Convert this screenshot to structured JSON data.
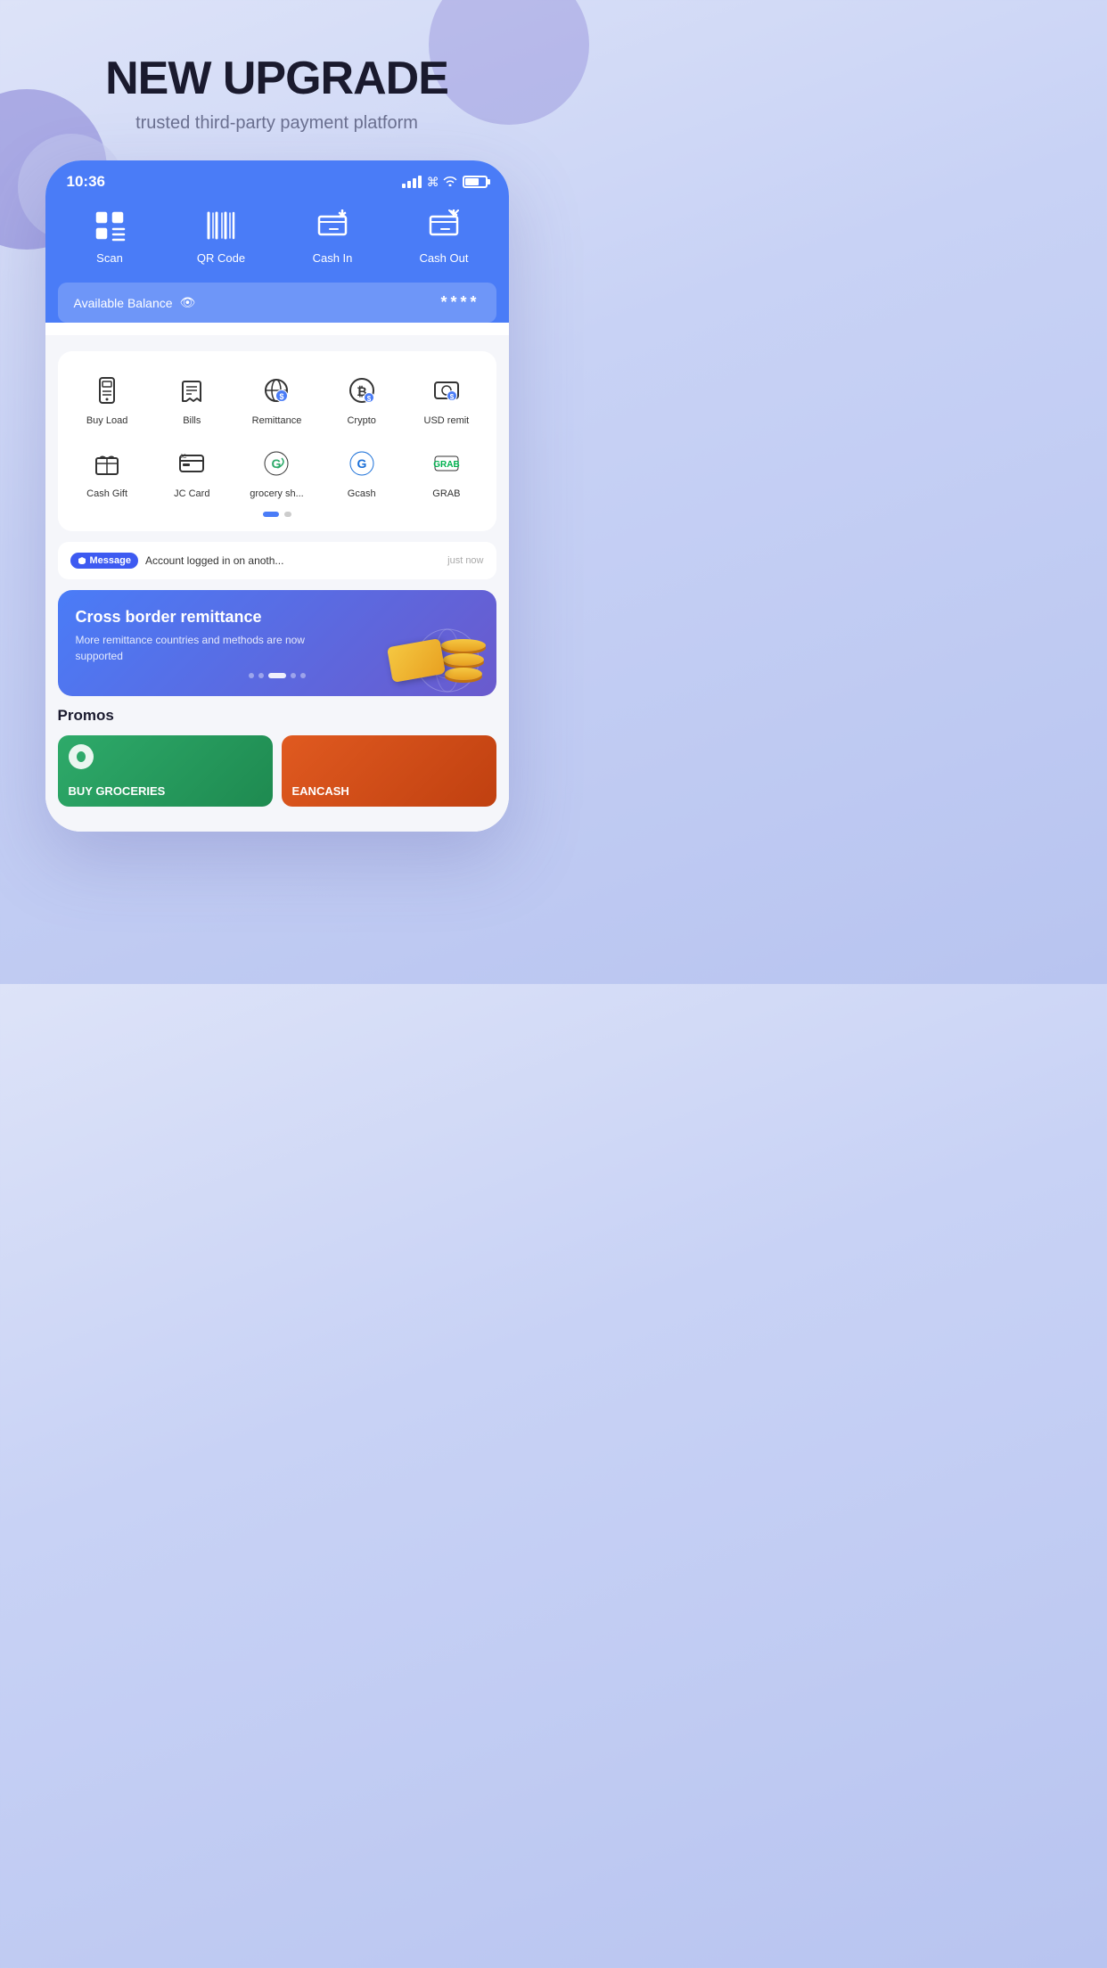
{
  "hero": {
    "title": "NEW UPGRADE",
    "subtitle": "trusted third-party payment platform"
  },
  "phone": {
    "statusBar": {
      "time": "10:36"
    },
    "quickActions": [
      {
        "id": "scan",
        "label": "Scan",
        "icon": "scan"
      },
      {
        "id": "qrcode",
        "label": "QR Code",
        "icon": "barcode"
      },
      {
        "id": "cashin",
        "label": "Cash In",
        "icon": "cashin"
      },
      {
        "id": "cashout",
        "label": "Cash Out",
        "icon": "cashout"
      }
    ],
    "balance": {
      "label": "Available Balance",
      "value": "****"
    },
    "services": [
      [
        {
          "id": "buyload",
          "label": "Buy Load",
          "icon": "phone"
        },
        {
          "id": "bills",
          "label": "Bills",
          "icon": "house"
        },
        {
          "id": "remittance",
          "label": "Remittance",
          "icon": "remittance"
        },
        {
          "id": "crypto",
          "label": "Crypto",
          "icon": "crypto"
        },
        {
          "id": "usdremit",
          "label": "USD remit",
          "icon": "usdremit"
        }
      ],
      [
        {
          "id": "cashgift",
          "label": "Cash Gift",
          "icon": "cashgift"
        },
        {
          "id": "jccard",
          "label": "JC Card",
          "icon": "jccard"
        },
        {
          "id": "grocery",
          "label": "grocery sh...",
          "icon": "grocery"
        },
        {
          "id": "gcash",
          "label": "Gcash",
          "icon": "gcash"
        },
        {
          "id": "grab",
          "label": "GRAB",
          "icon": "grab"
        }
      ]
    ],
    "message": {
      "badge": "Message",
      "text": "Account logged in on anoth...",
      "time": "just now"
    },
    "banner": {
      "title": "Cross border remittance",
      "description": "More remittance countries and methods are now supported"
    },
    "promos": {
      "title": "Promos",
      "items": [
        {
          "id": "promo1",
          "label": "BUY GROCERIES",
          "color": "green"
        },
        {
          "id": "promo2",
          "label": "EANCASH",
          "color": "orange"
        }
      ]
    }
  },
  "colors": {
    "accent": "#4a7cf7",
    "dark": "#1a1a2e",
    "text_muted": "#6b7090"
  }
}
